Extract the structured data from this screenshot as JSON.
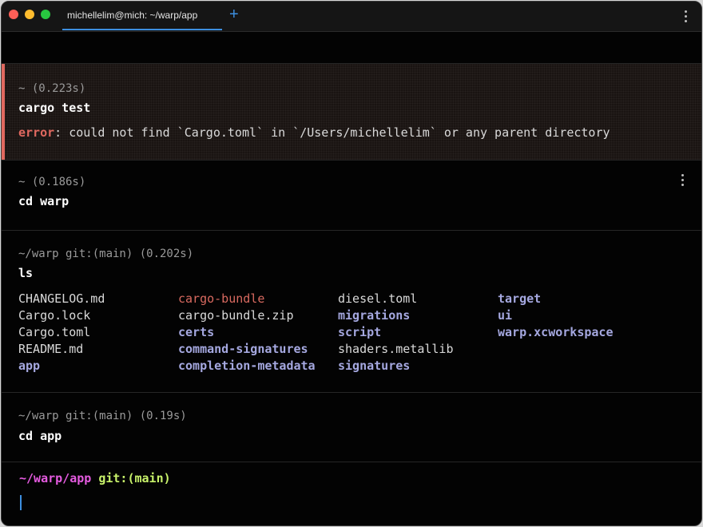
{
  "window": {
    "tab_title": "michellelim@mich: ~/warp/app",
    "tab_add": "+"
  },
  "blocks": [
    {
      "meta": "~ (0.223s)",
      "command": "cargo test",
      "error_label": "error",
      "error_message": ": could not find `Cargo.toml` in `/Users/michellelim` or any parent directory"
    },
    {
      "meta": "~ (0.186s)",
      "command": "cd warp"
    },
    {
      "meta": "~/warp git:(main) (0.202s)",
      "command": "ls",
      "ls_output": [
        [
          "CHANGELOG.md",
          "cargo-bundle",
          "diesel.toml",
          "target"
        ],
        [
          "Cargo.lock",
          "cargo-bundle.zip",
          "migrations",
          "ui"
        ],
        [
          "Cargo.toml",
          "certs",
          "script",
          "warp.xcworkspace"
        ],
        [
          "README.md",
          "command-signatures",
          "shaders.metallib",
          ""
        ],
        [
          "app",
          "completion-metadata",
          "signatures",
          ""
        ]
      ]
    },
    {
      "meta": "~/warp git:(main) (0.19s)",
      "command": "cd app"
    }
  ],
  "prompt": {
    "path": "~/warp/app",
    "git": "git:(main)"
  },
  "colors": {
    "error": "#e0685f",
    "directory": "#a5a8e0",
    "prompt_path": "#e55be0",
    "prompt_git": "#c8f26a",
    "accent": "#3d8fe0"
  }
}
